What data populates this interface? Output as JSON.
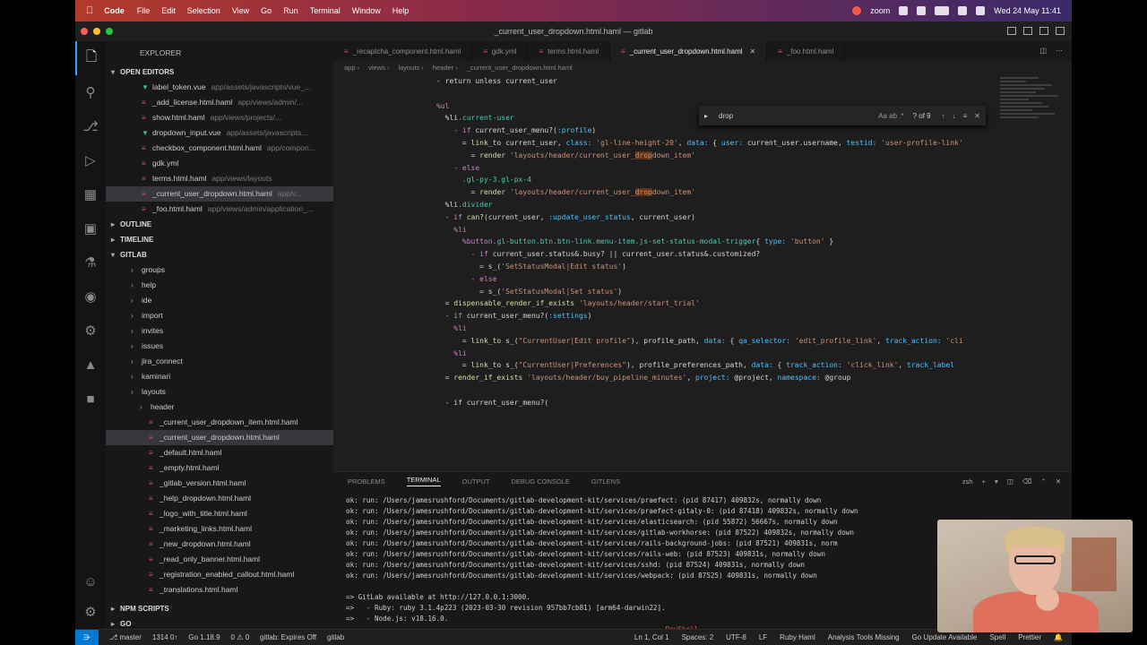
{
  "menubar": {
    "app": "Code",
    "items": [
      "File",
      "Edit",
      "Selection",
      "View",
      "Go",
      "Run",
      "Terminal",
      "Window",
      "Help"
    ],
    "zoom": "zoom",
    "clock": "Wed 24 May  11:41"
  },
  "window": {
    "title": "_current_user_dropdown.html.haml — gitlab"
  },
  "sidebar": {
    "header": "EXPLORER",
    "open_editors_label": "OPEN EDITORS",
    "open_editors": [
      {
        "icon": "vue",
        "name": "label_token.vue",
        "desc": "app/assets/javascripts/vue_..."
      },
      {
        "icon": "haml",
        "name": "_add_license.html.haml",
        "desc": "app/views/admin/..."
      },
      {
        "icon": "haml",
        "name": "show.html.haml",
        "desc": "app/views/projects/..."
      },
      {
        "icon": "vue",
        "name": "dropdown_input.vue",
        "desc": "app/assets/javascripts..."
      },
      {
        "icon": "haml",
        "name": "checkbox_component.html.haml",
        "desc": "app/compon..."
      },
      {
        "icon": "haml",
        "name": "gdk.yml",
        "desc": ""
      },
      {
        "icon": "haml",
        "name": "terms.html.haml",
        "desc": "app/views/layouts"
      },
      {
        "icon": "haml",
        "name": "_current_user_dropdown.html.haml",
        "desc": "app/v..."
      },
      {
        "icon": "haml",
        "name": "_foo.html.haml",
        "desc": "app/views/admin/application_..."
      }
    ],
    "outline_label": "OUTLINE",
    "timeline_label": "TIMELINE",
    "project_label": "GITLAB",
    "tree": [
      {
        "name": "groups",
        "type": "fold",
        "indent": 2
      },
      {
        "name": "help",
        "type": "fold",
        "indent": 2
      },
      {
        "name": "ide",
        "type": "fold",
        "indent": 2
      },
      {
        "name": "import",
        "type": "fold",
        "indent": 2
      },
      {
        "name": "invites",
        "type": "fold",
        "indent": 2
      },
      {
        "name": "issues",
        "type": "fold",
        "indent": 2
      },
      {
        "name": "jira_connect",
        "type": "fold",
        "indent": 2
      },
      {
        "name": "kaminari",
        "type": "fold",
        "indent": 2
      },
      {
        "name": "layouts",
        "type": "fold",
        "indent": 2
      },
      {
        "name": "header",
        "type": "fold",
        "indent": 3
      },
      {
        "name": "_current_user_dropdown_item.html.haml",
        "type": "haml",
        "indent": 4
      },
      {
        "name": "_current_user_dropdown.html.haml",
        "type": "haml",
        "indent": 4,
        "selected": true
      },
      {
        "name": "_default.html.haml",
        "type": "haml",
        "indent": 4
      },
      {
        "name": "_empty.html.haml",
        "type": "haml",
        "indent": 4
      },
      {
        "name": "_gitlab_version.html.haml",
        "type": "haml",
        "indent": 4
      },
      {
        "name": "_help_dropdown.html.haml",
        "type": "haml",
        "indent": 4
      },
      {
        "name": "_logo_with_title.html.haml",
        "type": "haml",
        "indent": 4
      },
      {
        "name": "_marketing_links.html.haml",
        "type": "haml",
        "indent": 4
      },
      {
        "name": "_new_dropdown.html.haml",
        "type": "haml",
        "indent": 4
      },
      {
        "name": "_read_only_banner.html.haml",
        "type": "haml",
        "indent": 4
      },
      {
        "name": "_registration_enabled_callout.html.haml",
        "type": "haml",
        "indent": 4
      },
      {
        "name": "_translations.html.haml",
        "type": "haml",
        "indent": 4
      }
    ],
    "npm_label": "NPM SCRIPTS",
    "go_label": "GO"
  },
  "tabs": [
    {
      "name": "_recaptcha_component.html.haml",
      "active": false
    },
    {
      "name": "gdk.yml",
      "active": false
    },
    {
      "name": "terms.html.haml",
      "active": false
    },
    {
      "name": "_current_user_dropdown.html.haml",
      "active": true
    },
    {
      "name": "_foo.html.haml",
      "active": false
    }
  ],
  "breadcrumb": [
    "app",
    "views",
    "layouts",
    "header",
    "_current_user_dropdown.html.haml"
  ],
  "find": {
    "query": "drop",
    "options": "Aa  ab  .*",
    "count": "? of 9"
  },
  "code": [
    {
      "ln": "",
      "t": [
        [
          "tx",
          "- return unless current_user"
        ]
      ]
    },
    {
      "ln": "",
      "t": []
    },
    {
      "ln": "",
      "t": [
        [
          "kw",
          "%ul"
        ]
      ]
    },
    {
      "ln": "",
      "t": [
        [
          "tx",
          "  %li"
        ],
        [
          "cls",
          ".current-user"
        ]
      ]
    },
    {
      "ln": "",
      "t": [
        [
          "kw",
          "    - if "
        ],
        [
          "tx",
          "current_user_menu?("
        ],
        [
          "sym",
          ":profile"
        ],
        [
          "tx",
          ")"
        ]
      ]
    },
    {
      "ln": "",
      "t": [
        [
          "tx",
          "      = "
        ],
        [
          "fn",
          "link_to "
        ],
        [
          "tx",
          "current_user, "
        ],
        [
          "sym",
          "class: "
        ],
        [
          "str",
          "'gl-line-height-20'"
        ],
        [
          "tx",
          ", "
        ],
        [
          "sym",
          "data: "
        ],
        [
          "tx",
          "{ "
        ],
        [
          "sym",
          "user: "
        ],
        [
          "tx",
          "current_user.username, "
        ],
        [
          "sym",
          "testid: "
        ],
        [
          "str",
          "'user-profile-link'"
        ]
      ]
    },
    {
      "ln": "",
      "t": [
        [
          "tx",
          "        = "
        ],
        [
          "fn",
          "render "
        ],
        [
          "str",
          "'layouts/header/current_user_"
        ],
        [
          "str hl",
          "drop"
        ],
        [
          "str",
          "down_item'"
        ]
      ]
    },
    {
      "ln": "",
      "t": [
        [
          "kw",
          "    - else"
        ]
      ]
    },
    {
      "ln": "",
      "t": [
        [
          "cls",
          "      .gl-py-3.gl-px-4"
        ]
      ]
    },
    {
      "ln": "",
      "t": [
        [
          "tx",
          "        = "
        ],
        [
          "fn",
          "render "
        ],
        [
          "str",
          "'layouts/header/current_user_"
        ],
        [
          "str hl",
          "drop"
        ],
        [
          "str",
          "down_item'"
        ]
      ]
    },
    {
      "ln": "",
      "t": [
        [
          "tx",
          "  %li"
        ],
        [
          "cls",
          ".divider"
        ]
      ]
    },
    {
      "ln": "",
      "t": [
        [
          "kw",
          "  - if "
        ],
        [
          "fn",
          "can?"
        ],
        [
          "tx",
          "(current_user, "
        ],
        [
          "sym",
          ":update_user_status"
        ],
        [
          "tx",
          ", current_user)"
        ]
      ]
    },
    {
      "ln": "",
      "t": [
        [
          "kw",
          "    %li"
        ]
      ]
    },
    {
      "ln": "",
      "t": [
        [
          "kw",
          "      %button"
        ],
        [
          "cls",
          ".gl-button.btn.btn-link.menu-item.js-set-status-modal-trigger"
        ],
        [
          "tx",
          "{ "
        ],
        [
          "sym",
          "type: "
        ],
        [
          "str",
          "'button'"
        ],
        [
          "tx",
          " }"
        ]
      ]
    },
    {
      "ln": "",
      "t": [
        [
          "kw",
          "        - if "
        ],
        [
          "tx",
          "current_user.status&.busy? || current_user.status&.customized?"
        ]
      ]
    },
    {
      "ln": "",
      "t": [
        [
          "tx",
          "          = s_("
        ],
        [
          "str",
          "'SetStatusModal|Edit status'"
        ],
        [
          "tx",
          ")"
        ]
      ]
    },
    {
      "ln": "",
      "t": [
        [
          "kw",
          "        - else"
        ]
      ]
    },
    {
      "ln": "",
      "t": [
        [
          "tx",
          "          = s_("
        ],
        [
          "str",
          "'SetStatusModal|Set status'"
        ],
        [
          "tx",
          ")"
        ]
      ]
    },
    {
      "ln": "",
      "t": [
        [
          "tx",
          "  = "
        ],
        [
          "fn",
          "dispensable_render_if_exists "
        ],
        [
          "str",
          "'layouts/header/start_trial'"
        ]
      ]
    },
    {
      "ln": "",
      "t": [
        [
          "kw",
          "  - if "
        ],
        [
          "tx",
          "current_user_menu?("
        ],
        [
          "sym",
          ":settings"
        ],
        [
          "tx",
          ")"
        ]
      ]
    },
    {
      "ln": "",
      "t": [
        [
          "kw",
          "    %li"
        ]
      ]
    },
    {
      "ln": "",
      "t": [
        [
          "tx",
          "      = "
        ],
        [
          "fn",
          "link_to "
        ],
        [
          "tx",
          "s_("
        ],
        [
          "str",
          "\"CurrentUser|Edit profile\""
        ],
        [
          "tx",
          "), profile_path, "
        ],
        [
          "sym",
          "data: "
        ],
        [
          "tx",
          "{ "
        ],
        [
          "sym",
          "qa_selector: "
        ],
        [
          "str",
          "'edit_profile_link'"
        ],
        [
          "tx",
          ", "
        ],
        [
          "sym",
          "track_action: "
        ],
        [
          "str",
          "'cli"
        ]
      ]
    },
    {
      "ln": "",
      "t": [
        [
          "kw",
          "    %li"
        ]
      ]
    },
    {
      "ln": "",
      "t": [
        [
          "tx",
          "      = "
        ],
        [
          "fn",
          "link_to "
        ],
        [
          "tx",
          "s_("
        ],
        [
          "str",
          "\"CurrentUser|Preferences\""
        ],
        [
          "tx",
          "), profile_preferences_path, "
        ],
        [
          "sym",
          "data: "
        ],
        [
          "tx",
          "{ "
        ],
        [
          "sym",
          "track_action: "
        ],
        [
          "str",
          "'click_link'"
        ],
        [
          "tx",
          ", "
        ],
        [
          "sym",
          "track_label"
        ]
      ]
    },
    {
      "ln": "",
      "t": [
        [
          "tx",
          "  = "
        ],
        [
          "fn",
          "render_if_exists "
        ],
        [
          "str",
          "'layouts/header/buy_pipeline_minutes'"
        ],
        [
          "tx",
          ", "
        ],
        [
          "sym",
          "project: "
        ],
        [
          "tx",
          "@project, "
        ],
        [
          "sym",
          "namespace: "
        ],
        [
          "tx",
          "@group"
        ]
      ]
    },
    {
      "ln": "",
      "t": []
    },
    {
      "ln": "",
      "t": [
        [
          "tx",
          "  - if "
        ],
        [
          "tx",
          "current_user_menu?("
        ]
      ]
    }
  ],
  "panel": {
    "tabs": [
      "PROBLEMS",
      "TERMINAL",
      "OUTPUT",
      "DEBUG CONSOLE",
      "GITLENS"
    ],
    "active_tab": "TERMINAL",
    "shell": "zsh"
  },
  "terminal": [
    {
      "c": "ok",
      "t": "ok: run: /Users/jamesrushford/Documents/gitlab-development-kit/services/praefect: (pid 87417) 409832s, normally down"
    },
    {
      "c": "ok",
      "t": "ok: run: /Users/jamesrushford/Documents/gitlab-development-kit/services/praefect-gitaly-0: (pid 87418) 409832s, normally down"
    },
    {
      "c": "ok",
      "t": "ok: run: /Users/jamesrushford/Documents/gitlab-development-kit/services/elasticsearch: (pid 55872) 56667s, normally down"
    },
    {
      "c": "ok",
      "t": "ok: run: /Users/jamesrushford/Documents/gitlab-development-kit/services/gitlab-workhorse: (pid 87522) 409832s, normally down"
    },
    {
      "c": "ok",
      "t": "ok: run: /Users/jamesrushford/Documents/gitlab-development-kit/services/rails-background-jobs: (pid 87521) 409831s, norm"
    },
    {
      "c": "ok",
      "t": "ok: run: /Users/jamesrushford/Documents/gitlab-development-kit/services/rails-web: (pid 87523) 409831s, normally down"
    },
    {
      "c": "ok",
      "t": "ok: run: /Users/jamesrushford/Documents/gitlab-development-kit/services/sshd: (pid 87524) 409831s, normally down"
    },
    {
      "c": "ok",
      "t": "ok: run: /Users/jamesrushford/Documents/gitlab-development-kit/services/webpack: (pid 87525) 409831s, normally down"
    },
    {
      "c": "ok",
      "t": ""
    },
    {
      "c": "gr",
      "t": "=> GitLab available at http://127.0.0.1:3000."
    },
    {
      "c": "gr",
      "t": "=>   - Ruby: ruby 3.1.4p223 (2023-03-30 revision 957bb7cb81) [arm64-darwin22]."
    },
    {
      "c": "gr",
      "t": "=>   - Node.js: v18.16.0."
    },
    {
      "c": "err",
      "t": "                                                                              DevShell"
    },
    {
      "c": "ok",
      "t": "> |"
    }
  ],
  "status": {
    "branch": "master",
    "sync": "1314 0↑",
    "go": "Go 1.18.9",
    "problems": "0 ⚠ 0",
    "tasks": "gitlab: Expires Off",
    "project": "gitlab",
    "cursor": "Ln 1, Col 1",
    "spaces": "Spaces: 2",
    "encoding": "UTF-8",
    "eol": "LF",
    "language": "Ruby Haml",
    "tools": "Analysis Tools Missing",
    "go_update": "Go Update Available",
    "spell": "Spell",
    "prettier": "Prettier"
  }
}
